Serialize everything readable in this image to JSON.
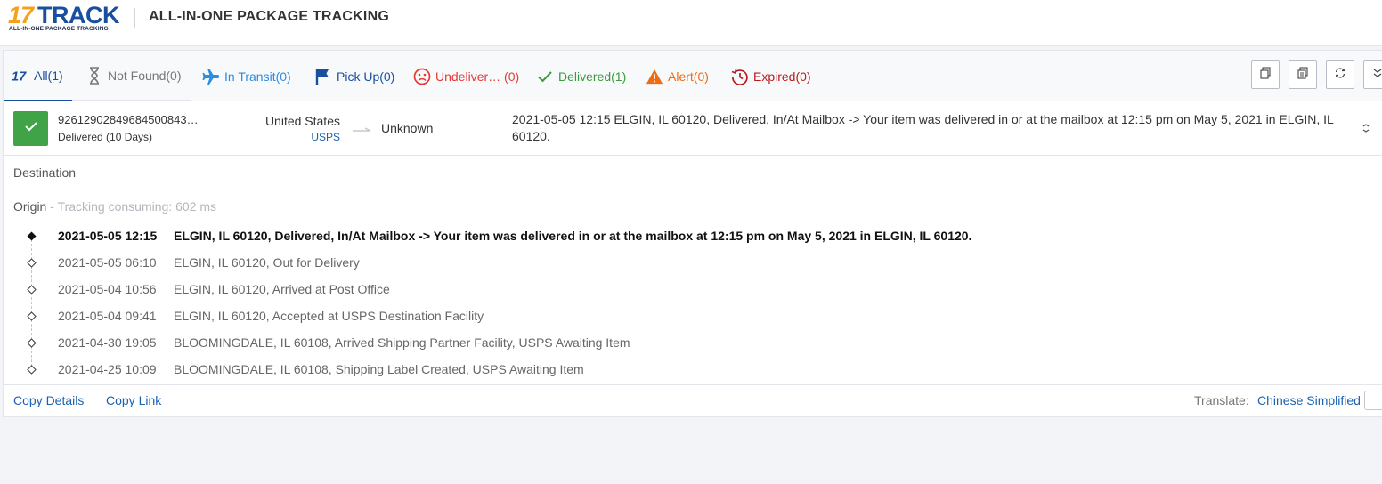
{
  "header": {
    "logo_number": "17",
    "logo_word": "TRACK",
    "logo_tagline": "ALL-IN-ONE PACKAGE TRACKING",
    "title": "ALL-IN-ONE PACKAGE TRACKING"
  },
  "tabs": [
    {
      "label": "All(1)",
      "icon": "17-logo-icon",
      "color": "#1a4fa0",
      "active": true
    },
    {
      "label": "Not Found(0)",
      "icon": "hourglass-icon",
      "color": "#777777"
    },
    {
      "label": "In Transit(0)",
      "icon": "airplane-icon",
      "color": "#2d8de0"
    },
    {
      "label": "Pick Up(0)",
      "icon": "flag-icon",
      "color": "#1a4fa0"
    },
    {
      "label": "Undeliver… (0)",
      "icon": "sad-face-icon",
      "color": "#e53935"
    },
    {
      "label": "Delivered(1)",
      "icon": "checkmark-icon",
      "color": "#3d9a3d"
    },
    {
      "label": "Alert(0)",
      "icon": "warning-triangle-icon",
      "color": "#f06a12"
    },
    {
      "label": "Expired(0)",
      "icon": "history-clock-icon",
      "color": "#b71c1c"
    }
  ],
  "toolbar": {
    "buttons": [
      "copy-icon",
      "copy-all-icon",
      "refresh-icon",
      "collapse-all-icon"
    ]
  },
  "shipment": {
    "tracking_number": "92612902849684500843…",
    "status": "Delivered (10 Days)",
    "origin_country": "United States",
    "carrier": "USPS",
    "destination_country": "Unknown",
    "latest_event": "2021-05-05 12:15  ELGIN, IL 60120, Delivered, In/At Mailbox -> Your item was delivered in or at the mailbox at 12:15 pm on May 5, 2021 in ELGIN, IL 60120.",
    "status_color": "#40a347"
  },
  "details": {
    "destination_label": "Destination",
    "origin_label": "Origin",
    "tracking_consuming": " - Tracking consuming: 602 ms",
    "events": [
      {
        "time": "2021-05-05 12:15",
        "desc": "ELGIN, IL 60120, Delivered, In/At Mailbox -> Your item was delivered in or at the mailbox at 12:15 pm on May 5, 2021 in ELGIN, IL 60120."
      },
      {
        "time": "2021-05-05 06:10",
        "desc": "ELGIN, IL 60120, Out for Delivery"
      },
      {
        "time": "2021-05-04 10:56",
        "desc": "ELGIN, IL 60120, Arrived at Post Office"
      },
      {
        "time": "2021-05-04 09:41",
        "desc": "ELGIN, IL 60120, Accepted at USPS Destination Facility"
      },
      {
        "time": "2021-04-30 19:05",
        "desc": "BLOOMINGDALE, IL 60108, Arrived Shipping Partner Facility, USPS Awaiting Item"
      },
      {
        "time": "2021-04-25 10:09",
        "desc": "BLOOMINGDALE, IL 60108, Shipping Label Created, USPS Awaiting Item"
      }
    ]
  },
  "footer": {
    "copy_details": "Copy Details",
    "copy_link": "Copy Link",
    "translate_label": "Translate:",
    "translate_language": "Chinese Simplified"
  }
}
